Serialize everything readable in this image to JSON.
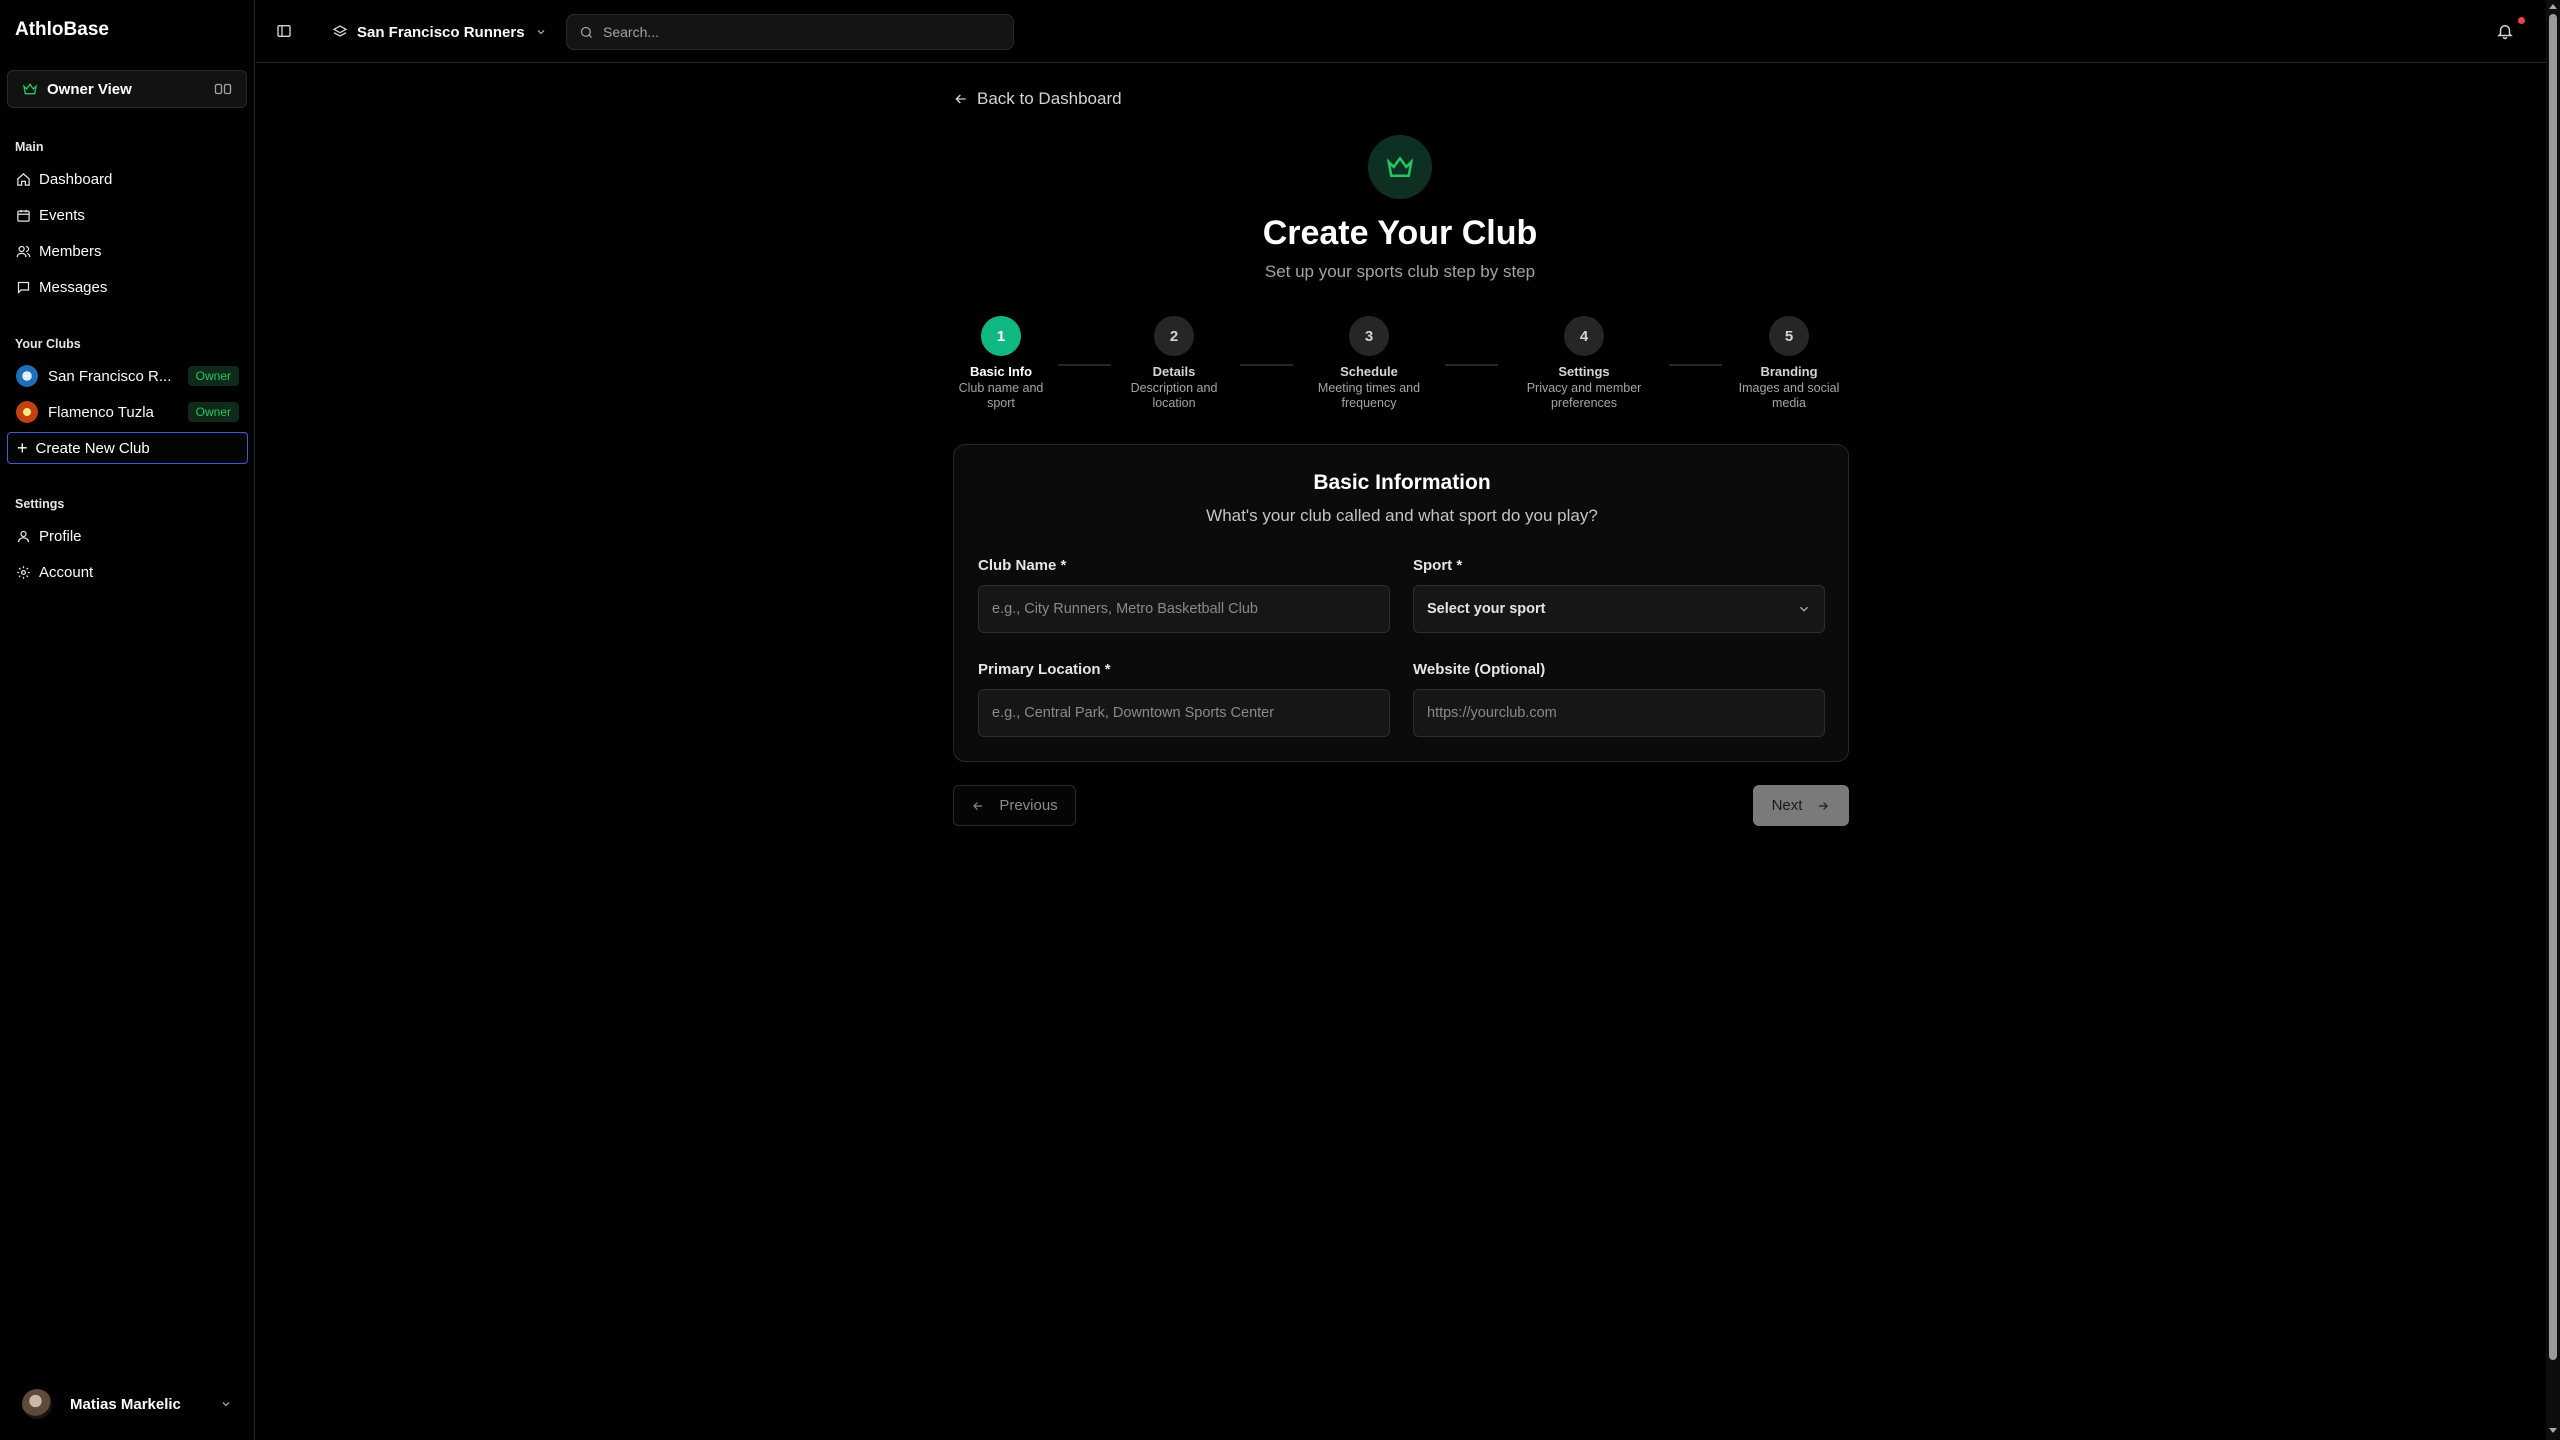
{
  "app": {
    "brand": "AthloBase"
  },
  "sidebar": {
    "view_label": "Owner View",
    "main_title": "Main",
    "main_items": [
      {
        "label": "Dashboard",
        "icon": "home-icon"
      },
      {
        "label": "Events",
        "icon": "calendar-icon"
      },
      {
        "label": "Members",
        "icon": "users-icon"
      },
      {
        "label": "Messages",
        "icon": "message-icon"
      }
    ],
    "clubs_title": "Your Clubs",
    "clubs": [
      {
        "name": "San Francisco R...",
        "badge": "Owner"
      },
      {
        "name": "Flamenco Tuzla",
        "badge": "Owner"
      }
    ],
    "create_label": "Create New Club",
    "settings_title": "Settings",
    "settings_items": [
      {
        "label": "Profile",
        "icon": "user-icon"
      },
      {
        "label": "Account",
        "icon": "gear-icon"
      }
    ],
    "user_name": "Matias Markelic"
  },
  "topbar": {
    "current_club": "San Francisco Runners",
    "search_placeholder": "Search..."
  },
  "main": {
    "back_label": "Back to Dashboard",
    "title": "Create Your Club",
    "subtitle": "Set up your sports club step by step",
    "steps": [
      {
        "num": "1",
        "title": "Basic Info",
        "desc1": "Club name and",
        "desc2": "sport",
        "active": true
      },
      {
        "num": "2",
        "title": "Details",
        "desc1": "Description and",
        "desc2": "location",
        "active": false
      },
      {
        "num": "3",
        "title": "Schedule",
        "desc1": "Meeting times and",
        "desc2": "frequency",
        "active": false
      },
      {
        "num": "4",
        "title": "Settings",
        "desc1": "Privacy and member",
        "desc2": "preferences",
        "active": false
      },
      {
        "num": "5",
        "title": "Branding",
        "desc1": "Images and social",
        "desc2": "media",
        "active": false
      }
    ],
    "form": {
      "title": "Basic Information",
      "subtitle": "What's your club called and what sport do you play?",
      "club_name_label": "Club Name *",
      "club_name_placeholder": "e.g., City Runners, Metro Basketball Club",
      "sport_label": "Sport *",
      "sport_value": "Select your sport",
      "location_label": "Primary Location *",
      "location_placeholder": "e.g., Central Park, Downtown Sports Center",
      "website_label": "Website (Optional)",
      "website_placeholder": "https://yourclub.com"
    },
    "prev_label": "Previous",
    "next_label": "Next"
  },
  "colors": {
    "accent": "#10b981",
    "badge_text": "#22c55e",
    "focus_border": "#3b5bdb",
    "notification": "#ef4444"
  }
}
